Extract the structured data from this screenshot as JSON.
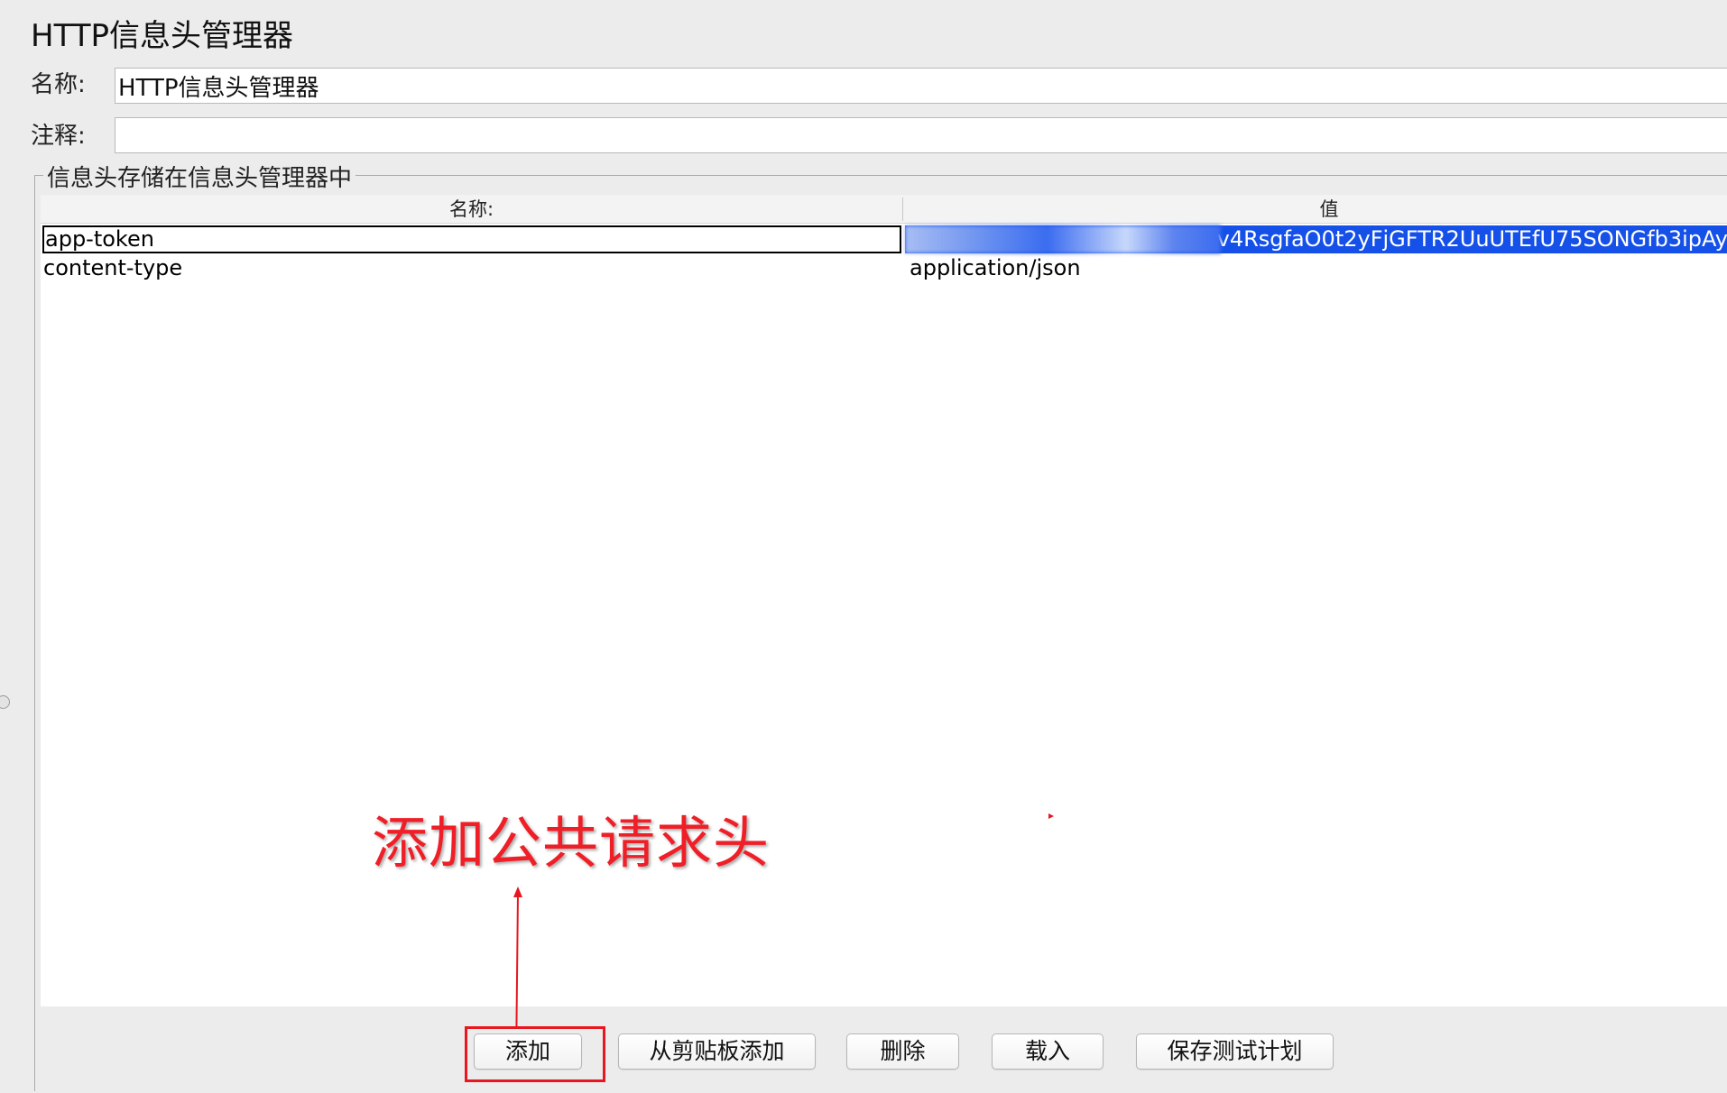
{
  "page": {
    "title": "HTTP信息头管理器"
  },
  "form": {
    "name_label": "名称:",
    "name_value": "HTTP信息头管理器",
    "comment_label": "注释:",
    "comment_value": ""
  },
  "headers_group": {
    "title": "信息头存储在信息头管理器中",
    "columns": [
      "名称:",
      "值"
    ],
    "rows": [
      {
        "name": "app-token",
        "value": "v4RsgfaO0t2yFjGFTR2UuUTEfU75SONGfb3ipAy",
        "selected": true,
        "value_partially_obscured": true
      },
      {
        "name": "content-type",
        "value": "application/json",
        "selected": false
      }
    ]
  },
  "buttons": {
    "add": "添加",
    "add_from_clipboard": "从剪贴板添加",
    "delete": "删除",
    "load": "载入",
    "save_test_plan": "保存测试计划"
  },
  "annotation": {
    "text": "添加公共请求头",
    "color": "#f01e26"
  },
  "colors": {
    "selection": "#1550e8",
    "annotation_red": "#e8161e",
    "background": "#ececec"
  }
}
